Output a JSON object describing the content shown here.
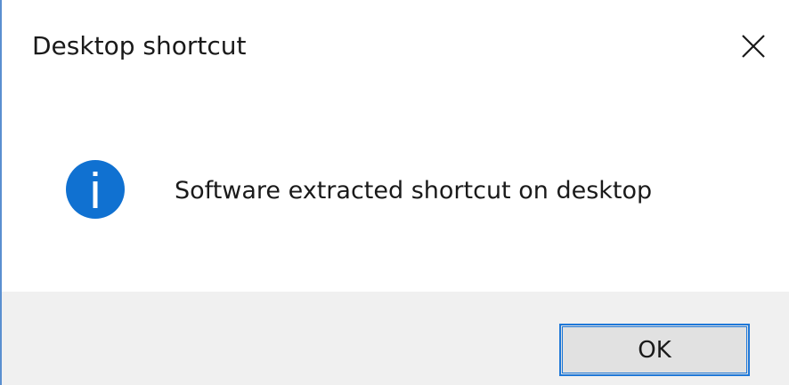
{
  "window": {
    "title": "Desktop shortcut",
    "close_icon": "close-icon"
  },
  "message": {
    "icon": "info-icon",
    "text": "Software extracted shortcut on desktop"
  },
  "footer": {
    "ok_label": "OK"
  },
  "colors": {
    "info_icon": "#1071d1",
    "button_border": "#1f78d8",
    "footer_bg": "#f0f0f0"
  }
}
